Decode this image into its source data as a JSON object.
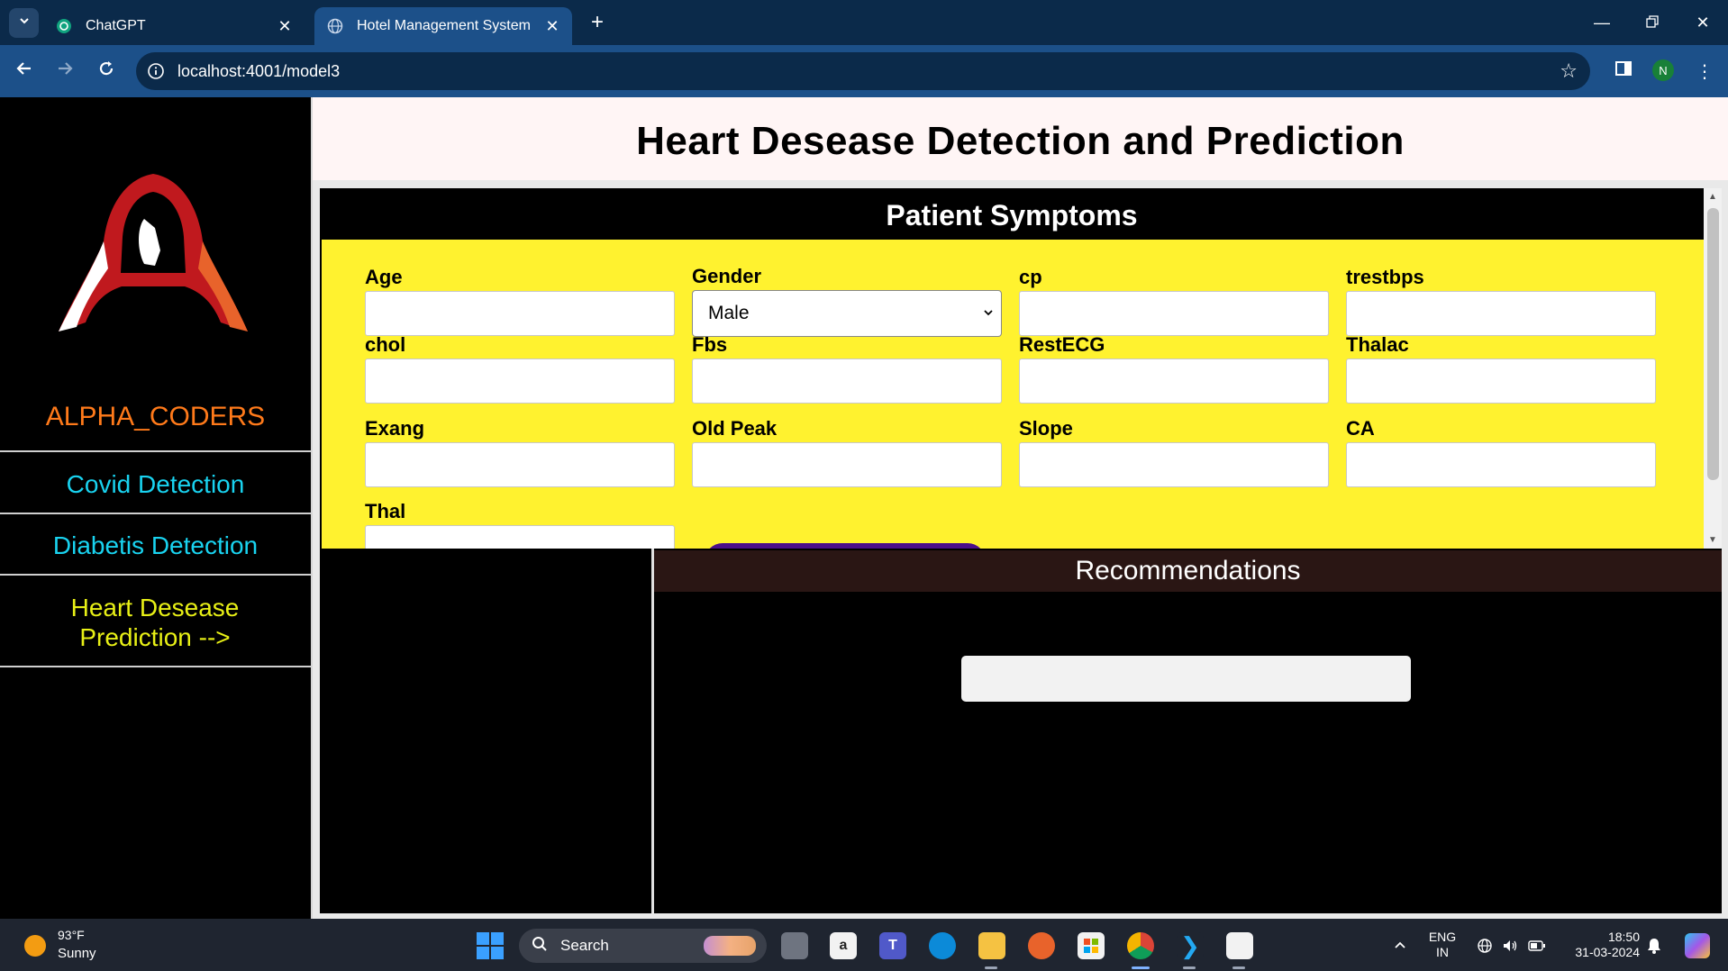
{
  "browser": {
    "tabs": [
      {
        "title": "ChatGPT",
        "active": false
      },
      {
        "title": "Hotel Management System",
        "active": true
      }
    ],
    "url": "localhost:4001/model3",
    "profile_initial": "N"
  },
  "sidebar": {
    "brand": "ALPHA_CODERS",
    "items": [
      {
        "label": "Covid Detection"
      },
      {
        "label": "Diabetis Detection"
      },
      {
        "label": "Heart Desease Prediction -->"
      }
    ]
  },
  "header": {
    "title": "Heart Desease Detection and Prediction"
  },
  "form": {
    "title": "Patient Symptoms",
    "fields": [
      {
        "label": "Age",
        "value": ""
      },
      {
        "label": "Gender",
        "value": "Male"
      },
      {
        "label": "cp",
        "value": ""
      },
      {
        "label": "trestbps",
        "value": ""
      },
      {
        "label": "chol",
        "value": ""
      },
      {
        "label": "Fbs",
        "value": ""
      },
      {
        "label": "RestECG",
        "value": ""
      },
      {
        "label": "Thalac",
        "value": ""
      },
      {
        "label": "Exang",
        "value": ""
      },
      {
        "label": "Old Peak",
        "value": ""
      },
      {
        "label": "Slope",
        "value": ""
      },
      {
        "label": "CA",
        "value": ""
      },
      {
        "label": "Thal",
        "value": ""
      }
    ]
  },
  "recommendations": {
    "title": "Recommendations",
    "output": ""
  },
  "taskbar": {
    "weather_temp": "93°F",
    "weather_condition": "Sunny",
    "search_label": "Search",
    "lang_line1": "ENG",
    "lang_line2": "IN",
    "time": "18:50",
    "date": "31-03-2024"
  },
  "colors": {
    "sidebar_brand": "#ff7a1a",
    "sidebar_link": "#19d3f0",
    "sidebar_active": "#e8f016",
    "form_background": "#fff22f",
    "predict_button": "#4b0f8a"
  }
}
